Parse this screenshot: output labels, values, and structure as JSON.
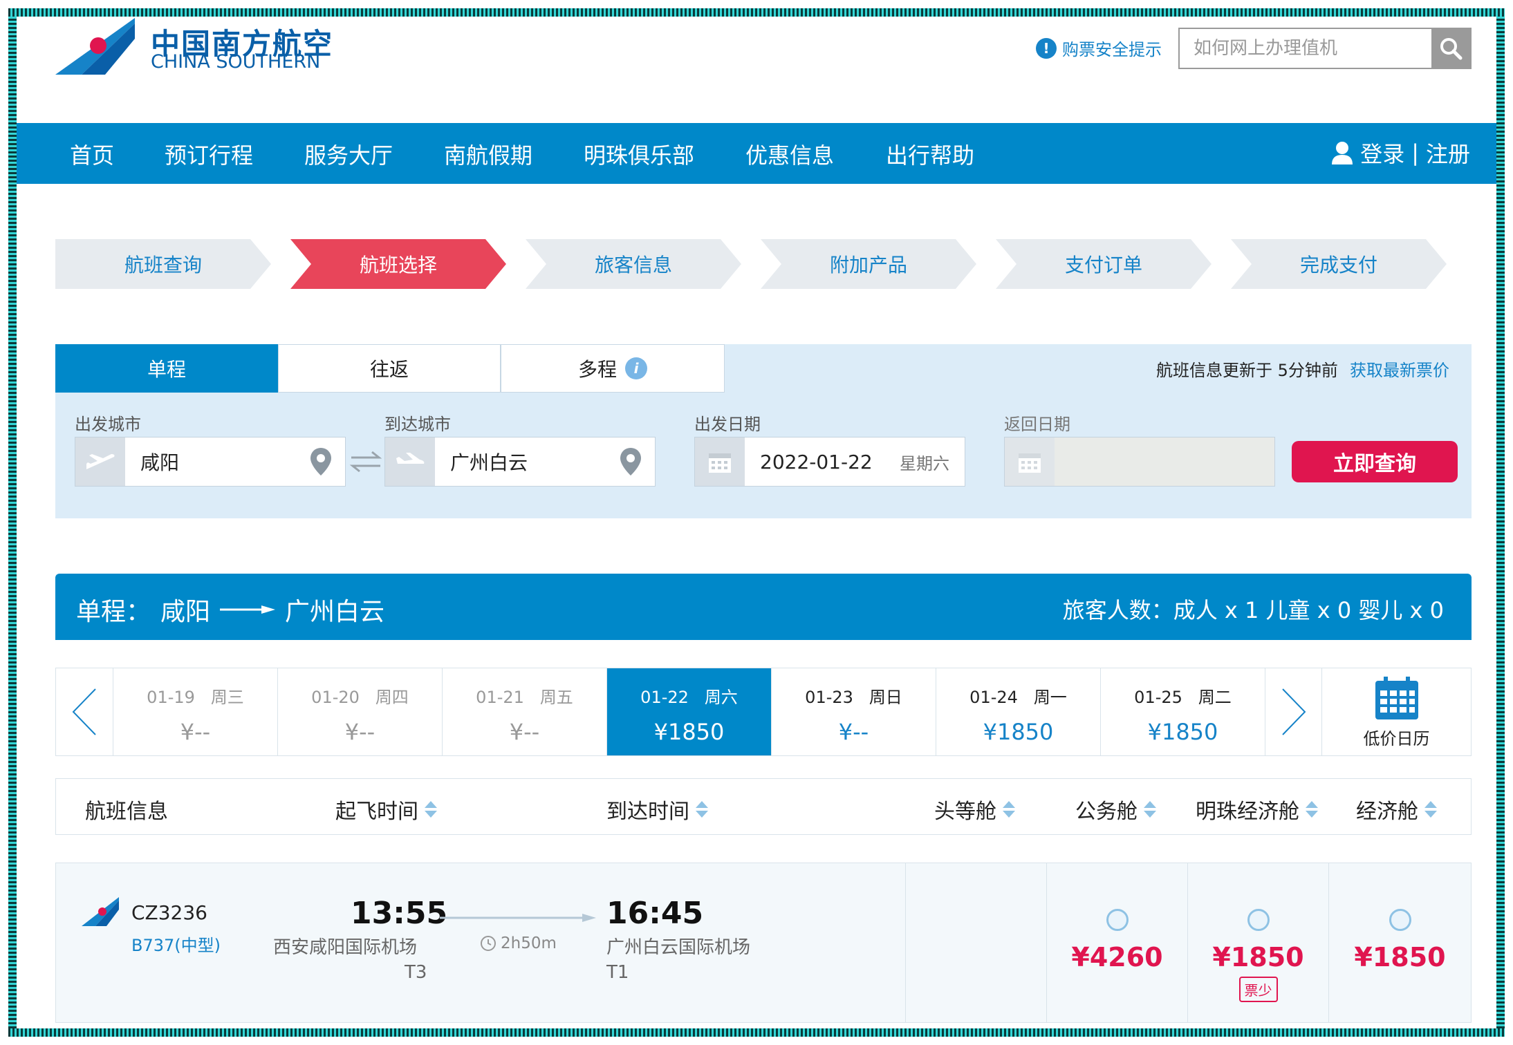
{
  "brand": {
    "name_cn": "中国南方航空",
    "name_en": "CHINA SOUTHERN",
    "color": "#0088c9"
  },
  "header": {
    "safety_tip": "购票安全提示",
    "search_placeholder": "如何网上办理值机"
  },
  "nav": {
    "items": [
      "首页",
      "预订行程",
      "服务大厅",
      "南航假期",
      "明珠俱乐部",
      "优惠信息",
      "出行帮助"
    ],
    "login": "登录",
    "separator": "|",
    "register": "注册"
  },
  "steps": {
    "items": [
      "航班查询",
      "航班选择",
      "旅客信息",
      "附加产品",
      "支付订单",
      "完成支付"
    ],
    "active_index": 1,
    "active_color": "#e8455a"
  },
  "search_panel": {
    "tabs": [
      "单程",
      "往返",
      "多程"
    ],
    "active_tab": 0,
    "update_text": "航班信息更新于 5分钟前",
    "refresh_link": "获取最新票价",
    "depart_city_label": "出发城市",
    "depart_city": "咸阳",
    "arrive_city_label": "到达城市",
    "arrive_city": "广州白云",
    "depart_date_label": "出发日期",
    "depart_date": "2022-01-22",
    "depart_weekday": "星期六",
    "return_date_label": "返回日期",
    "return_date": "",
    "submit": "立即查询"
  },
  "route_bar": {
    "prefix": "单程：",
    "from": "咸阳",
    "to": "广州白云",
    "passengers": "旅客人数：成人 x 1 儿童 x 0 婴儿 x 0"
  },
  "date_strip": {
    "days": [
      {
        "date": "01-19",
        "weekday": "周三",
        "price": "¥--",
        "state": "past"
      },
      {
        "date": "01-20",
        "weekday": "周四",
        "price": "¥--",
        "state": "past"
      },
      {
        "date": "01-21",
        "weekday": "周五",
        "price": "¥--",
        "state": "past"
      },
      {
        "date": "01-22",
        "weekday": "周六",
        "price": "¥1850",
        "state": "selected"
      },
      {
        "date": "01-23",
        "weekday": "周日",
        "price": "¥--",
        "state": "available"
      },
      {
        "date": "01-24",
        "weekday": "周一",
        "price": "¥1850",
        "state": "available"
      },
      {
        "date": "01-25",
        "weekday": "周二",
        "price": "¥1850",
        "state": "available"
      }
    ],
    "calendar_label": "低价日历"
  },
  "table_header": {
    "flight_info": "航班信息",
    "depart_time": "起飞时间",
    "arrive_time": "到达时间",
    "first": "头等舱",
    "business": "公务舱",
    "pearl_economy": "明珠经济舱",
    "economy": "经济舱"
  },
  "flights": [
    {
      "flight_no": "CZ3236",
      "aircraft": "B737(中型)",
      "depart_time": "13:55",
      "depart_airport": "西安咸阳国际机场",
      "depart_terminal": "T3",
      "duration": "2h50m",
      "arrive_time": "16:45",
      "arrive_airport": "广州白云国际机场",
      "arrive_terminal": "T1",
      "first_price": "",
      "business_price": "¥4260",
      "pearl_economy_price": "¥1850",
      "pearl_economy_badge": "票少",
      "economy_price": "¥1850"
    }
  ]
}
